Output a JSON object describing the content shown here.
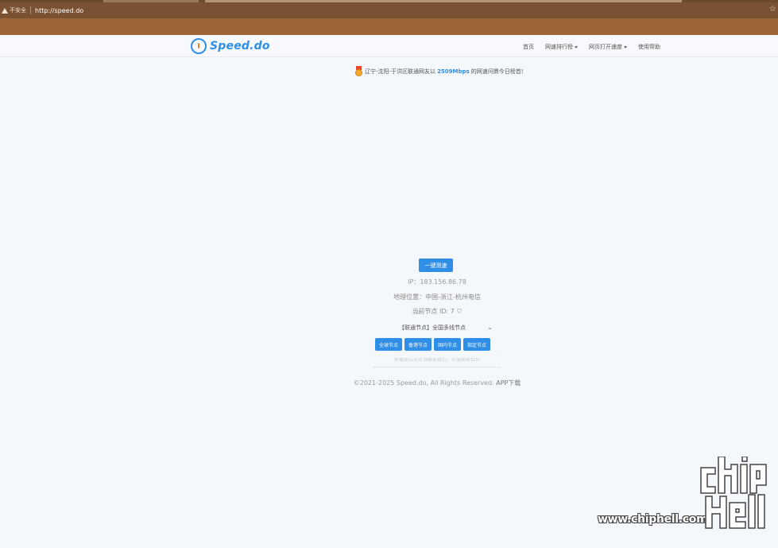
{
  "browser": {
    "security_label": "不安全",
    "url": "http://speed.do"
  },
  "header": {
    "logo_text": "Speed.do",
    "nav": [
      {
        "label": "首页"
      },
      {
        "label": "网速排行榜"
      },
      {
        "label": "网页打开速度"
      },
      {
        "label": "使用帮助"
      }
    ]
  },
  "announcement": {
    "prefix": "辽宁-沈阳-于洪区联通网友以",
    "speed": "2509Mbps",
    "suffix": "的网速问鼎今日榜首!"
  },
  "test": {
    "button_label": "一键测速",
    "ip": "IP：183.156.86.78",
    "geo": "地理位置：中国-浙江-杭州电信",
    "node_prefix": "当前节点 ID: 7",
    "selected_node": "【联通节点】全国多线节点",
    "node_buttons": [
      "全球节点",
      "香港节点",
      "国内节点",
      "指定节点"
    ],
    "faded_text": "新增测试节点请联系我们，欢迎商务合作"
  },
  "footer": {
    "copyright": "©2021-2025 Speed.do, All Rights Reserved.",
    "app_link": "APP下载"
  },
  "watermark": {
    "site": "www.chiphell.com",
    "logo_text": "chip hell"
  },
  "colors": {
    "accent": "#2f8ee5",
    "address_bar": "#7a5233",
    "toolbar": "#9b6538",
    "background": "#f4f7fb"
  }
}
